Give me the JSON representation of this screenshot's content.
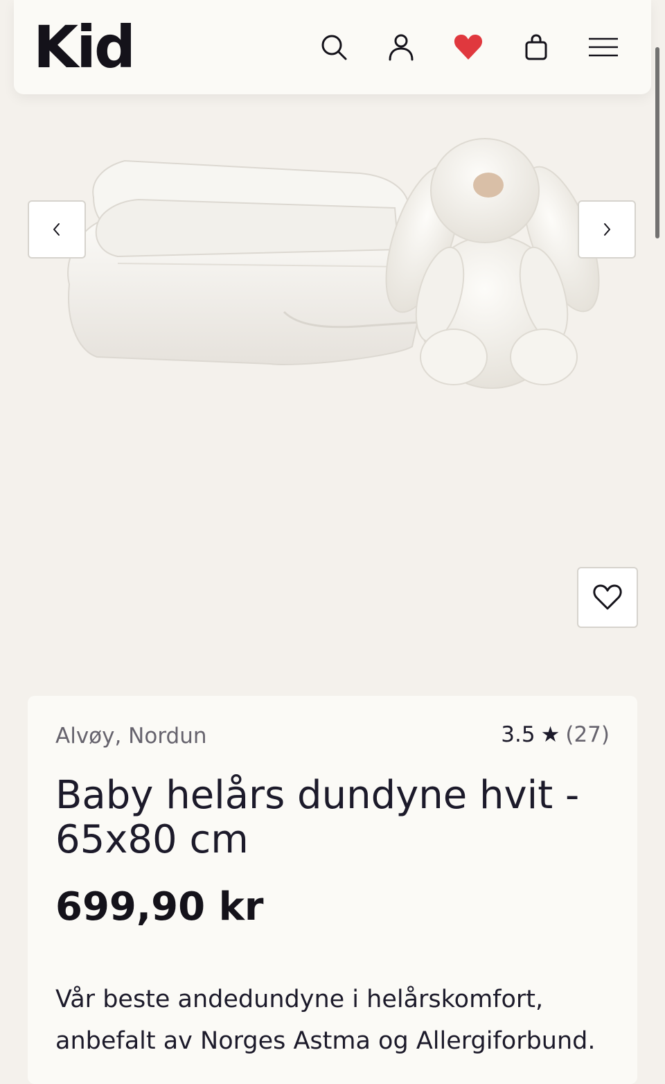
{
  "header": {
    "logo": "Kid",
    "icons": {
      "search": "search-icon",
      "account": "user-icon",
      "wishlist": "heart-icon",
      "cart": "shopping-bag-icon",
      "menu": "menu-icon"
    },
    "wishlist_color": "#e0383e"
  },
  "gallery": {
    "image_alt": "Baby helårs dundyne hvit - 65x80 cm",
    "prev_icon": "chevron-left-icon",
    "next_icon": "chevron-right-icon",
    "favorite_icon": "heart-outline-icon"
  },
  "product": {
    "brand": "Alvøy, Nordun",
    "rating": "3.5",
    "rating_star": "★",
    "review_count": "(27)",
    "title": "Baby helårs dundyne hvit - 65x80 cm",
    "price": "699,90 kr",
    "description": "Vår beste andedundyne i helårskomfort, anbefalt av Norges Astma og Allergiforbund."
  },
  "colors": {
    "background": "#f4f1ec",
    "card": "#fbfaf6",
    "text": "#1c1a2a",
    "muted": "#66636d"
  }
}
